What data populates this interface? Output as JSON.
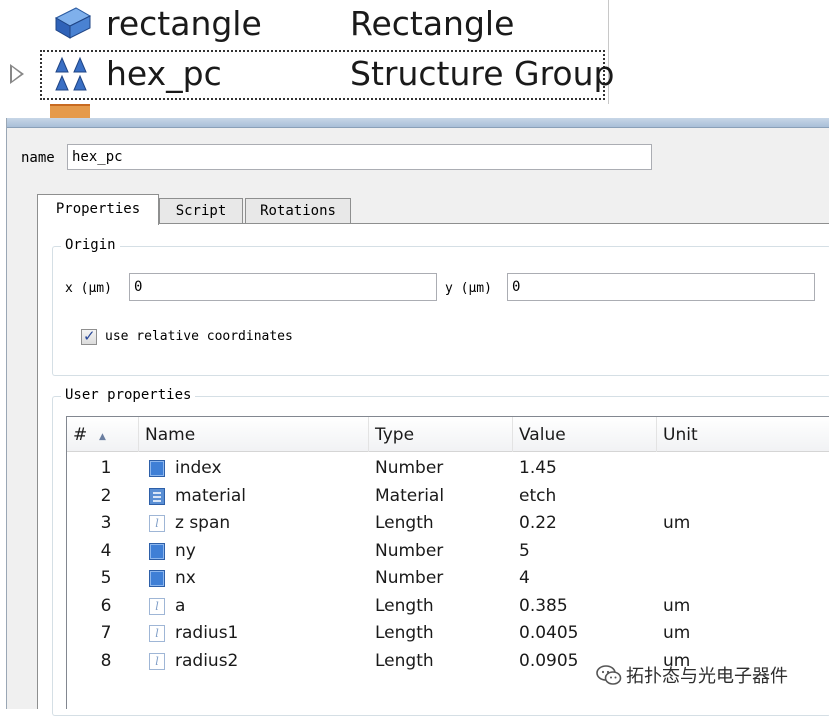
{
  "tree": {
    "rows": [
      {
        "name": "rectangle",
        "type": "Rectangle",
        "icon": "rectangle-icon"
      },
      {
        "name": "hex_pc",
        "type": "Structure Group",
        "icon": "structure-group-icon",
        "selected": true
      }
    ]
  },
  "editor": {
    "name_label": "name",
    "name_value": "hex_pc",
    "tabs": [
      {
        "label": "Properties",
        "active": true
      },
      {
        "label": "Script",
        "active": false
      },
      {
        "label": "Rotations",
        "active": false
      }
    ],
    "origin": {
      "title": "Origin",
      "x_label": "x (μm)",
      "x_value": "0",
      "y_label": "y (μm)",
      "y_value": "0",
      "relative_label": "use relative coordinates",
      "relative_checked": true
    },
    "user_properties": {
      "title": "User properties",
      "columns": [
        "#",
        "Name",
        "Type",
        "Value",
        "Unit"
      ],
      "rows": [
        {
          "num": "1",
          "name": "index",
          "type": "Number",
          "value": "1.45",
          "unit": "",
          "icon": "number"
        },
        {
          "num": "2",
          "name": "material",
          "type": "Material",
          "value": "etch",
          "unit": "",
          "icon": "material"
        },
        {
          "num": "3",
          "name": "z span",
          "type": "Length",
          "value": "0.22",
          "unit": "um",
          "icon": "length"
        },
        {
          "num": "4",
          "name": "ny",
          "type": "Number",
          "value": "5",
          "unit": "",
          "icon": "number"
        },
        {
          "num": "5",
          "name": "nx",
          "type": "Number",
          "value": "4",
          "unit": "",
          "icon": "number"
        },
        {
          "num": "6",
          "name": "a",
          "type": "Length",
          "value": "0.385",
          "unit": "um",
          "icon": "length"
        },
        {
          "num": "7",
          "name": "radius1",
          "type": "Length",
          "value": "0.0405",
          "unit": "um",
          "icon": "length"
        },
        {
          "num": "8",
          "name": "radius2",
          "type": "Length",
          "value": "0.0905",
          "unit": "um",
          "icon": "length"
        }
      ]
    }
  },
  "watermark": {
    "text": "拓扑态与光电子器件"
  },
  "colors": {
    "accent_blue": "#3f7fd6",
    "panel_bg": "#f0f0f0",
    "border": "#8e8f8f"
  }
}
